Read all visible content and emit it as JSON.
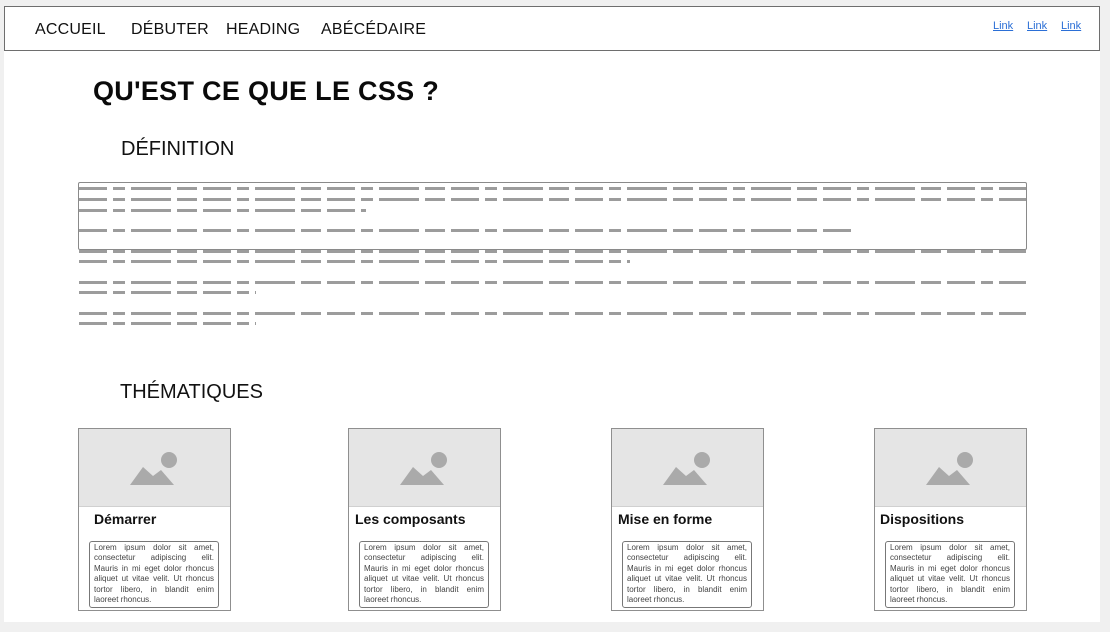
{
  "nav": {
    "items": [
      "ACCUEIL",
      "DÉBUTER",
      "HEADING",
      "ABÉCÉDAIRE"
    ],
    "links": [
      "Link",
      "Link",
      "Link"
    ]
  },
  "page": {
    "title": "QU'EST CE QUE LE CSS ?",
    "definition_heading": "DÉFINITION",
    "themes_heading": "THÉMATIQUES"
  },
  "cards": [
    {
      "title": "Démarrer",
      "text": "Lorem ipsum dolor sit amet, consectetur adipiscing elit. Mauris in mi eget dolor rhoncus aliquet ut vitae velit. Ut rhoncus tortor libero, in blandit enim laoreet rhoncus."
    },
    {
      "title": "Les composants",
      "text": "Lorem ipsum dolor sit amet, consectetur adipiscing elit. Mauris in mi eget dolor rhoncus aliquet ut vitae velit. Ut rhoncus tortor libero, in blandit enim laoreet rhoncus."
    },
    {
      "title": "Mise en forme",
      "text": "Lorem ipsum dolor sit amet, consectetur adipiscing elit. Mauris in mi eget dolor rhoncus aliquet ut vitae velit. Ut rhoncus tortor libero, in blandit enim laoreet rhoncus."
    },
    {
      "title": "Dispositions",
      "text": "Lorem ipsum dolor sit amet, consectetur adipiscing elit. Mauris in mi eget dolor rhoncus aliquet ut vitae velit. Ut rhoncus tortor libero, in blandit enim laoreet rhoncus."
    }
  ],
  "icons": {
    "card_image": "image-placeholder-icon"
  },
  "colors": {
    "link": "#2b6fd6",
    "placeholder_bg": "#e5e5e5",
    "text_placeholder": "#9c9c9c"
  }
}
